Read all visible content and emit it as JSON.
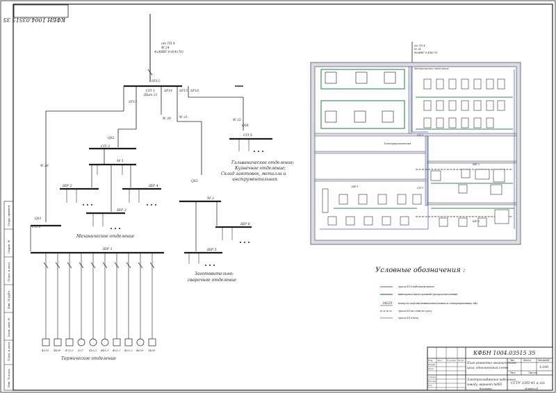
{
  "drawing": {
    "stamp_mirror": "КФБН 1004.03515 35",
    "title_bottom_left": "Термическое отделение",
    "label_mech": "Механическое отделение",
    "label_zag_1": "Заготовительно-",
    "label_zag_2": "сварочное отделение",
    "label_galv_1": "Гальваническое отделение;",
    "label_galv_2": "Кузнечное отделение;",
    "label_galv_3": "Склад заготовок, металла и",
    "label_galv_4": "инструментальная.",
    "feed_left_1": "от ТП 4",
    "feed_left_2": "W 24",
    "feed_left_3": "4xАВВГ-0.4(4x70)",
    "feed_right_1": "от ТП 4",
    "feed_right_2": "W 24",
    "feed_right_3": "4xАВВГ-0.4(4x70)",
    "boards": {
      "sp1": "СП 1",
      "sp1_sub": "Щит 21",
      "sp2": "СП 2",
      "sp3": "СП 3",
      "sp5": "СП 5",
      "shr1": "ШР 1",
      "shr2": "ШР 2",
      "shr3": "ШР 3",
      "shr4": "ШР 4",
      "shr5": "ШР 5",
      "shr6": "ШР 6",
      "m1": "М 1",
      "m2": "М 2"
    },
    "breakers": {
      "sf12": "SF12",
      "sf13": "SF13",
      "sf14": "SF14",
      "sf15": "SF15",
      "sf16": "SF16",
      "qs1": "QS1",
      "qs2": "QS2",
      "qs3": "QS3",
      "qs4": "QS4"
    },
    "cables": {
      "w25": "W 25",
      "w26": "W 26",
      "w30": "W 30",
      "w31": "W 31",
      "w32": "W 32"
    },
    "receiver_labels": [
      "43/25",
      "44/30",
      "47/2,2",
      "52/7",
      "41/2,2",
      "44/1,5",
      "45/2,2",
      "40/2,2",
      "46/30",
      "34/30"
    ],
    "shop_title": "Механическое отделение",
    "plan_room_labels": [
      "Заготовительное",
      "Электроремонтная",
      "Склад",
      "ШР 1",
      "ШР 2",
      "ШР 3",
      "ШР 4",
      "ШР 5",
      "ШР 6",
      "СП 1",
      "СП 2"
    ]
  },
  "legend": {
    "title": "Условные обозначения :",
    "items": [
      {
        "text": "-трасса КЛ в кабельном канале",
        "color": "#4a5bd4"
      },
      {
        "text": "-шинопровод магистральный (распределительный)",
        "color": "#2f8a4a"
      },
      {
        "text": "-номер по перечню/номинальная мощность электроприемника, кВт",
        "color": "#1b1b1b",
        "sample": "34/25"
      },
      {
        "text": "-трасса КЛ на стене по тросу",
        "color": "#1b1b1b"
      },
      {
        "text": "-трасса КЛ в полу",
        "color": "#4a5bd4"
      }
    ]
  },
  "title_block": {
    "code": "КФБН 1004.03515 35",
    "title_1": "План ремонтно-механического",
    "title_2": "цеха, однолинейная схема",
    "title_3": "Электроснабжение кабельных",
    "title_4": "заводу, вариант №065",
    "headers": [
      "Лит.",
      "Масса",
      "Масштаб"
    ],
    "scale": "1:100",
    "sheet_label": "Лист",
    "sheets_label": "Листов",
    "org": "СГТУ 3ЭП-41 а-з/о",
    "rows": [
      "Изм.",
      "Лист",
      "№ докум.",
      "Подп.",
      "Дата",
      "Разраб.",
      "Пров.",
      "Т.контр.",
      "Н.контр.",
      "Утв."
    ],
    "bottom_left": "Копировал",
    "bottom_right": "Формат  А1"
  },
  "left_strip": [
    "Перв. примен.",
    "Справ. №",
    "Подп. и дата",
    "Инв. № дубл.",
    "Взам. инв. №",
    "Подп. и дата",
    "Инв. № подл."
  ]
}
